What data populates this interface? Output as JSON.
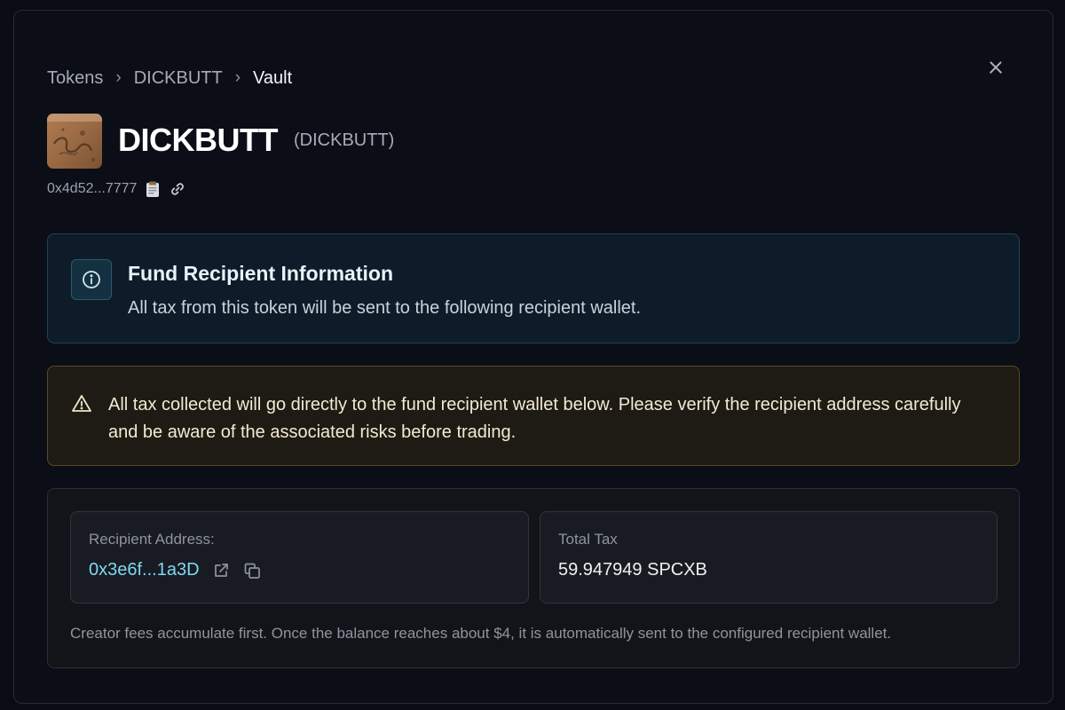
{
  "breadcrumb": {
    "items": [
      "Tokens",
      "DICKBUTT",
      "Vault"
    ],
    "separator": "›"
  },
  "token": {
    "name": "DICKBUTT",
    "symbol": "(DICKBUTT)",
    "address_short": "0x4d52...7777",
    "icons": [
      "clipboard-icon",
      "link-icon"
    ]
  },
  "info": {
    "title": "Fund Recipient Information",
    "text": "All tax from this token will be sent to the following recipient wallet.",
    "icon": "info-icon"
  },
  "warning": {
    "text": "All tax collected will go directly to the fund recipient wallet below. Please verify the recipient address carefully and be aware of the associated risks before trading.",
    "icon": "warning-icon"
  },
  "details": {
    "recipient_label": "Recipient Address:",
    "recipient_address": "0x3e6f...1a3D",
    "total_tax_label": "Total Tax",
    "total_tax_value": "59.947949 SPCXB",
    "note": "Creator fees accumulate first. Once the balance reaches about $4, it is automatically sent to the configured recipient wallet."
  },
  "colors": {
    "background": "#0b0e17",
    "info_accent": "#7fd7f2",
    "warning_accent": "#e8c46a",
    "link": "#7fd7f2"
  }
}
